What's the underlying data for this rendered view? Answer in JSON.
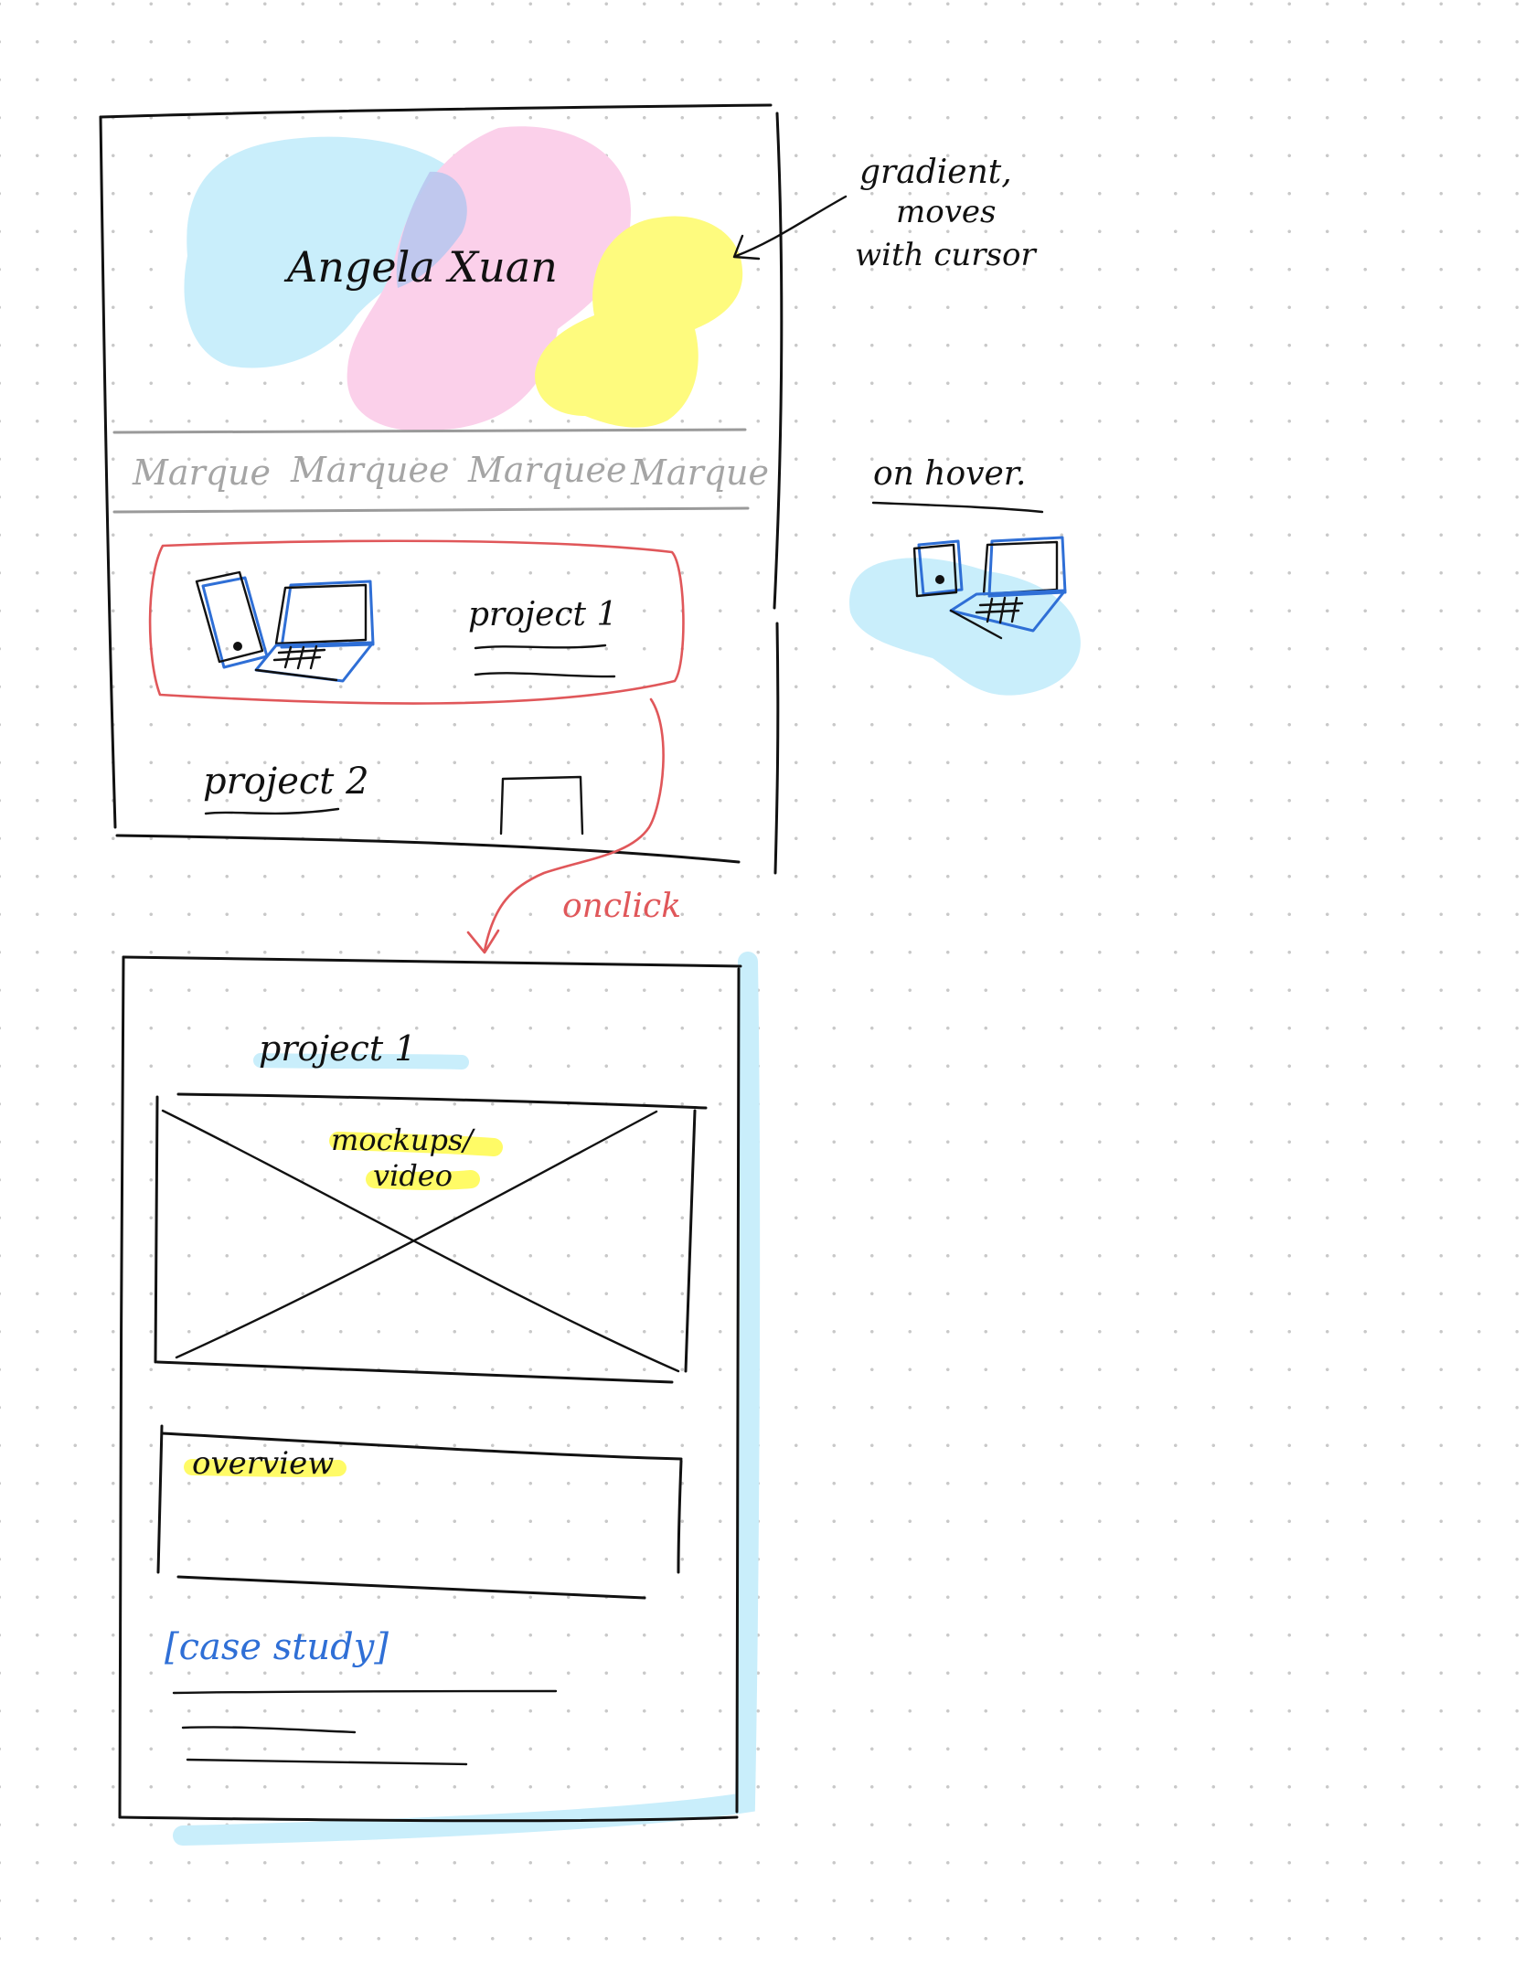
{
  "home_wireframe": {
    "name": "Angela Xuan",
    "marquee_words": [
      "Marque",
      "Marquee",
      "Marquee",
      "Marque"
    ],
    "project_1_label": "project 1",
    "project_2_label": "project 2"
  },
  "annotations": {
    "gradient_note_lines": [
      "gradient,",
      "moves",
      "with cursor"
    ],
    "hover_note": "on hover.",
    "click_note": "onclick"
  },
  "project_page_wireframe": {
    "title": "project 1",
    "media_placeholder_lines": [
      "mockups/",
      "video"
    ],
    "overview_label": "overview",
    "case_study_link": "[case study]"
  },
  "colors": {
    "blob_blue": "#c9eefb",
    "blob_pink": "#fbd0ea",
    "blob_yellow": "#fefb7e",
    "blob_overlap": "#b9c6ee",
    "highlight_yellow": "#fffb66",
    "highlight_blue": "#c9eefb",
    "click_flow": "#e0575a",
    "device_stroke": "#2f6fd6",
    "link_blue": "#2f6fd6"
  }
}
